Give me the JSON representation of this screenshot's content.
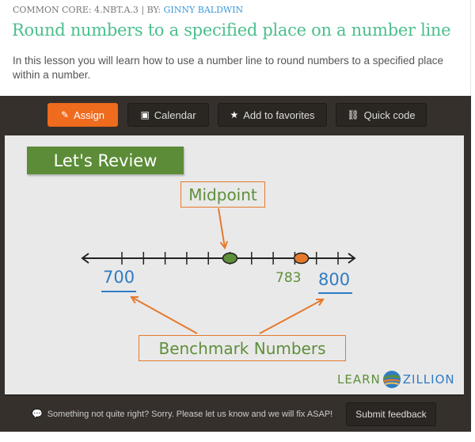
{
  "header": {
    "standard_prefix": "COMMON CORE: 4.NBT.A.3 | BY: ",
    "author": "GINNY BALDWIN",
    "title": "Round numbers to a specified place on a number line",
    "description": "In this lesson you will learn how to use a number line to round numbers to a specified place within a number."
  },
  "toolbar": {
    "buttons": [
      {
        "label": "Assign",
        "icon": "pencil-icon",
        "glyph": "✎"
      },
      {
        "label": "Calendar",
        "icon": "calendar-icon",
        "glyph": "▣"
      },
      {
        "label": "Add to favorites",
        "icon": "star-icon",
        "glyph": "★"
      },
      {
        "label": "Quick code",
        "icon": "link-icon",
        "glyph": "⛓"
      }
    ]
  },
  "slide": {
    "heading": "Let's Review",
    "midpoint_label": "Midpoint",
    "benchmark_label": "Benchmark Numbers",
    "number_line": {
      "left_benchmark": "700",
      "right_benchmark": "800",
      "value": "783",
      "ticks": 10,
      "midpoint_value": 750
    },
    "logo": {
      "part1": "LEARN",
      "part2": "ZILLION"
    },
    "colors": {
      "green": "#5e8f3a",
      "orange": "#e57a2d",
      "blue": "#2f7cc4"
    }
  },
  "feedback": {
    "message": "Something not quite right? Sorry. Please let us know and we will fix ASAP!",
    "button_label": "Submit feedback"
  }
}
